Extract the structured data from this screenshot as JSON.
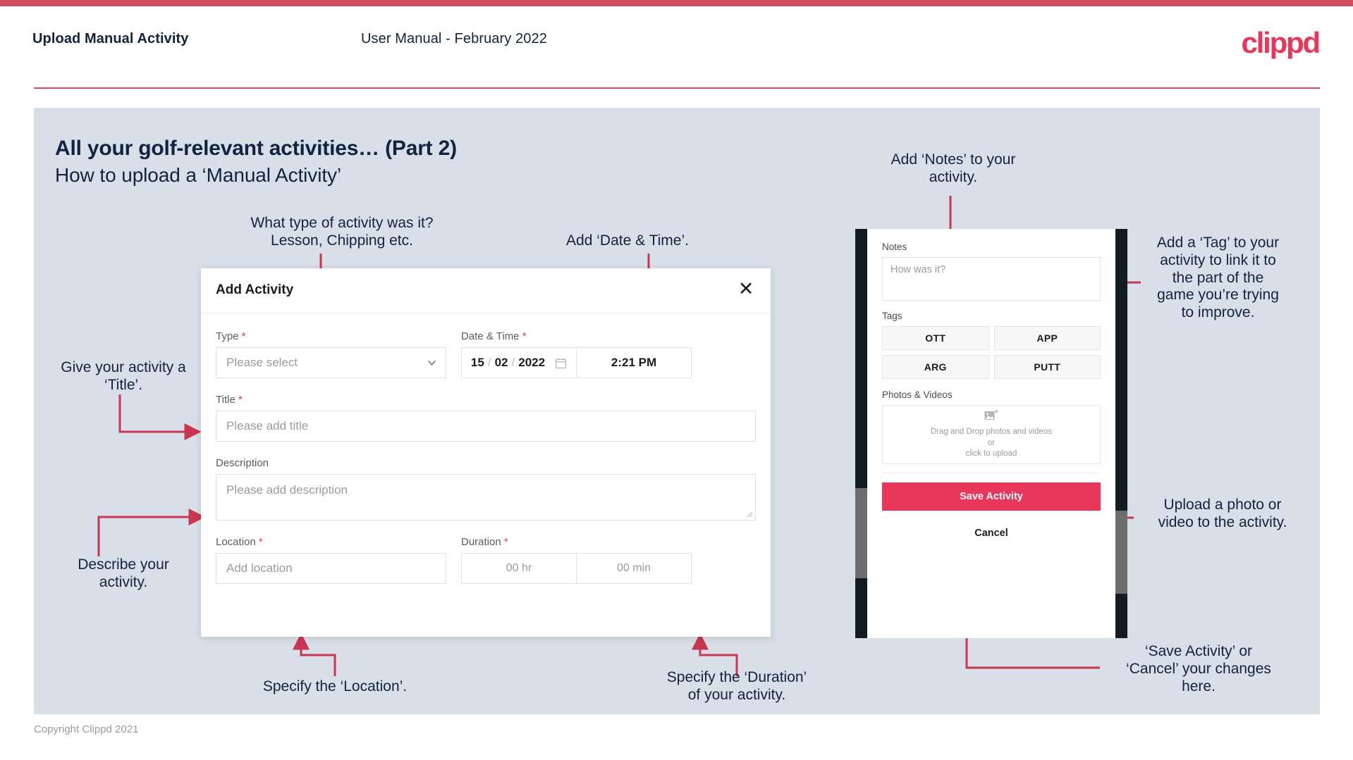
{
  "header": {
    "title": "Upload Manual Activity",
    "subtitle": "User Manual - February 2022",
    "logo": "clippd"
  },
  "slide": {
    "title": "All your golf-relevant activities… (Part 2)",
    "subtitle": "How to upload a ‘Manual Activity’"
  },
  "footer": {
    "copyright": "Copyright Clippd 2021"
  },
  "colors": {
    "accent": "#e8375a",
    "accent_rule": "#cf4c61",
    "arrow": "#c8374f",
    "slide_bg": "#d9dfe8",
    "text_dark": "#12233f",
    "phone_edge": "#111c23"
  },
  "modal": {
    "title": "Add Activity",
    "close_icon": "close-icon",
    "fields": {
      "type": {
        "label": "Type",
        "required": true,
        "placeholder": "Please select",
        "icon": "chevron-down-icon"
      },
      "datetime": {
        "label": "Date & Time",
        "required": true,
        "day": "15",
        "month": "02",
        "year": "2022",
        "separator": "/",
        "calendar_icon": "calendar-icon",
        "time": "2:21 PM"
      },
      "title": {
        "label": "Title",
        "required": true,
        "placeholder": "Please add title"
      },
      "description": {
        "label": "Description",
        "required": false,
        "placeholder": "Please add description"
      },
      "location": {
        "label": "Location",
        "required": true,
        "placeholder": "Add location"
      },
      "duration": {
        "label": "Duration",
        "required": true,
        "hours_placeholder": "00 hr",
        "minutes_placeholder": "00 min"
      }
    }
  },
  "phone": {
    "notes": {
      "label": "Notes",
      "placeholder": "How was it?"
    },
    "tags": {
      "label": "Tags",
      "items": [
        "OTT",
        "APP",
        "ARG",
        "PUTT"
      ]
    },
    "photos": {
      "label": "Photos & Videos",
      "icon": "add-image-icon",
      "drop_line1": "Drag and Drop photos and videos or",
      "drop_line2": "click to upload"
    },
    "save_label": "Save Activity",
    "cancel_label": "Cancel"
  },
  "annotations": {
    "type": {
      "line1": "What type of activity was it?",
      "line2": "Lesson, Chipping etc."
    },
    "datetime": {
      "line1": "Add ‘Date & Time’."
    },
    "title": {
      "line1": "Give your activity a",
      "line2": "‘Title’."
    },
    "description": {
      "line1": "Describe your",
      "line2": "activity."
    },
    "location": {
      "line1": "Specify the ‘Location’."
    },
    "duration": {
      "line1": "Specify the ‘Duration’",
      "line2": "of your activity."
    },
    "notes": {
      "line1": "Add ‘Notes’ to your",
      "line2": "activity."
    },
    "tags": {
      "line1": "Add a ‘Tag’ to your",
      "line2": "activity to link it to",
      "line3": "the part of the",
      "line4": "game you’re trying",
      "line5": "to improve."
    },
    "photos": {
      "line1": "Upload a photo or",
      "line2": "video to the activity."
    },
    "save": {
      "line1": "‘Save Activity’ or",
      "line2": "‘Cancel’ your changes",
      "line3": "here."
    }
  }
}
